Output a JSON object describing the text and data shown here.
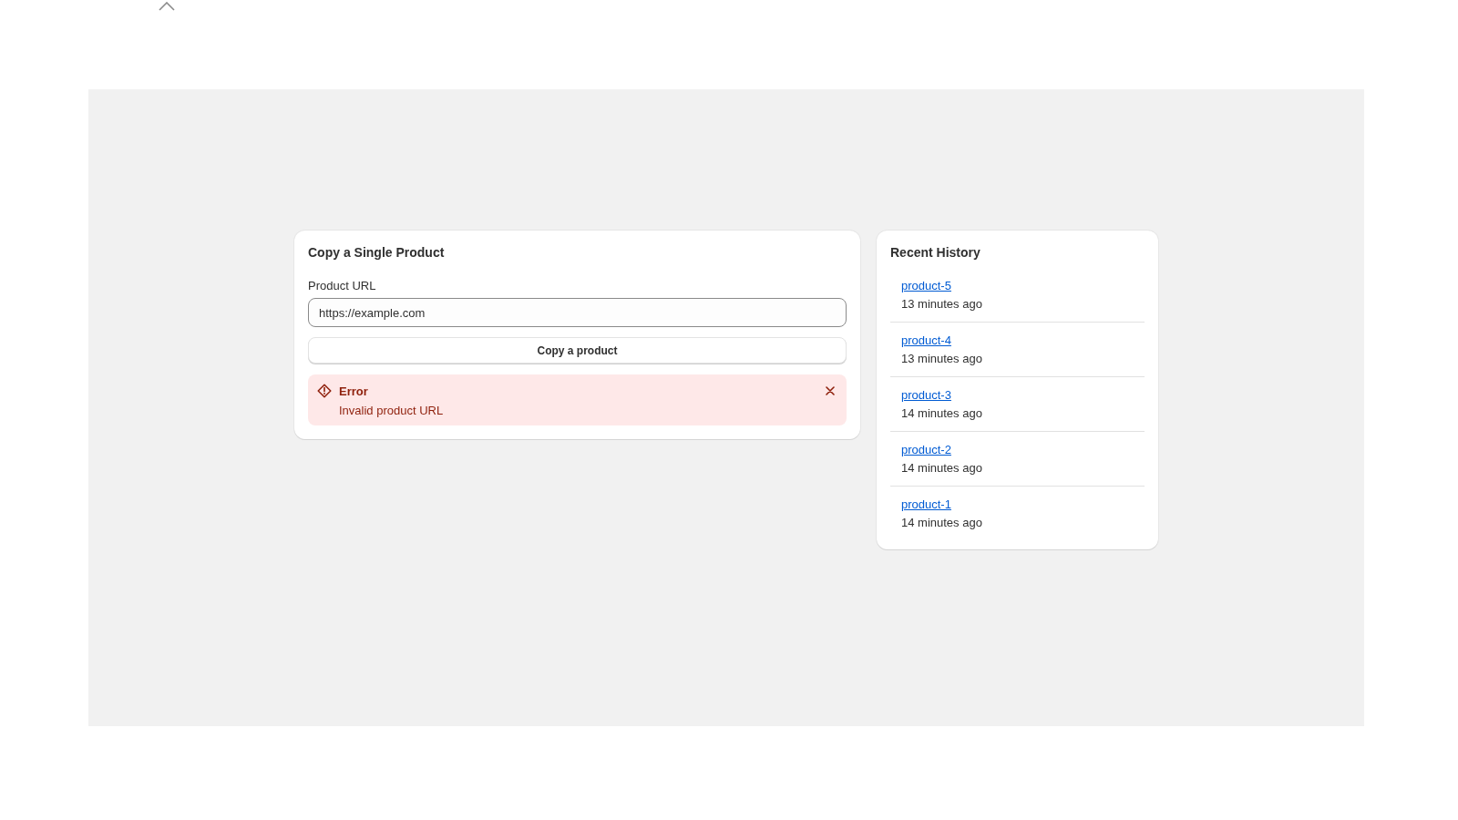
{
  "copy_card": {
    "title": "Copy a Single Product",
    "url_field": {
      "label": "Product URL",
      "value": "https://example.com"
    },
    "button": "Copy a product",
    "error": {
      "title": "Error",
      "message": "Invalid product URL"
    }
  },
  "history": {
    "title": "Recent History",
    "items": [
      {
        "link": "product-5",
        "time": "13 minutes ago"
      },
      {
        "link": "product-4",
        "time": "13 minutes ago"
      },
      {
        "link": "product-3",
        "time": "14 minutes ago"
      },
      {
        "link": "product-2",
        "time": "14 minutes ago"
      },
      {
        "link": "product-1",
        "time": "14 minutes ago"
      }
    ]
  }
}
